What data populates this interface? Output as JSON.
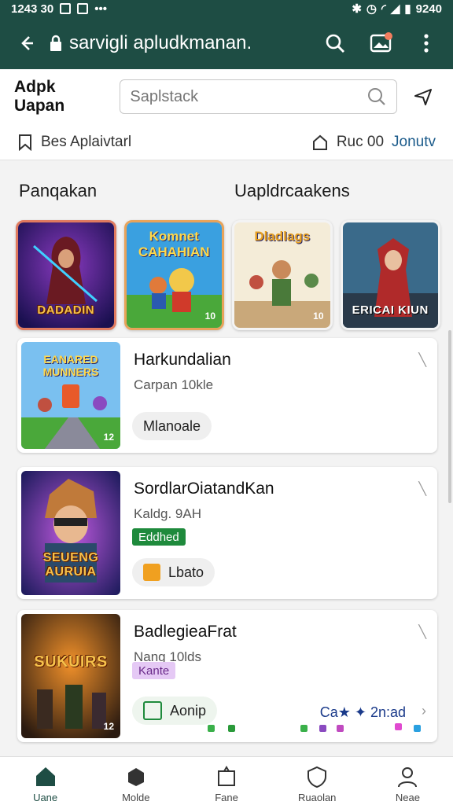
{
  "status_bar": {
    "time": "1243 30",
    "right_text": "9240"
  },
  "app_bar": {
    "title": "sarvigli apludkmanan."
  },
  "header": {
    "label": "Adpk Uapan",
    "search_placeholder": "Saplstack"
  },
  "filter_row": {
    "left_label": "Bes  Aplaivtarl",
    "right_label": "Ruc 00",
    "right_accent": "Jonutv"
  },
  "tabs": [
    {
      "label": "Panqakan"
    },
    {
      "label": "Uapldrcaakens"
    }
  ],
  "featured_games": [
    {
      "name": "DADADIN",
      "top": "",
      "badge": ""
    },
    {
      "name": "",
      "top": "Komnet CAHAHIAN",
      "badge": "10"
    },
    {
      "name": "",
      "top": "Dladlags",
      "badge": "10"
    },
    {
      "name": "ERICAI KIUN",
      "top": "",
      "badge": ""
    }
  ],
  "cards": [
    {
      "title": "Harkundalian",
      "subtitle": "Carpan 10kle",
      "chip": "",
      "pill": "Mlanoale",
      "thumb_text": "EANARED MUNNERS",
      "thumb_badge": "12"
    },
    {
      "title": "SordlarOiatandKan",
      "subtitle": "Kaldg. 9AH",
      "chip": "Eddhed",
      "pill": "Lbato",
      "thumb_text": "SEUENG AURUIA",
      "thumb_badge": ""
    },
    {
      "title": "BadlegieaFrat",
      "subtitle": "Nang 10lds",
      "chip": "Kante",
      "pill": "Aonip",
      "thumb_text": "SUKUIRS",
      "thumb_badge": "12",
      "promo": "Ca★ ✦ 2n:ad"
    }
  ],
  "bottom_nav": [
    {
      "label": "Uane",
      "icon": "home-icon",
      "active": true
    },
    {
      "label": "Molde",
      "icon": "cube-icon",
      "active": false
    },
    {
      "label": "Fane",
      "icon": "tag-icon",
      "active": false
    },
    {
      "label": "Ruaolan",
      "icon": "shield-icon",
      "active": false
    },
    {
      "label": "Neae",
      "icon": "person-icon",
      "active": false
    }
  ],
  "colors": {
    "app_bar": "#1e4d44",
    "accent_green": "#1e8a3c",
    "chip_green": "#1e8a3c",
    "chip_purple": "#e5c9f5",
    "tile_border_1": "#e07a5f",
    "tile_border_2": "#e8a35a"
  }
}
